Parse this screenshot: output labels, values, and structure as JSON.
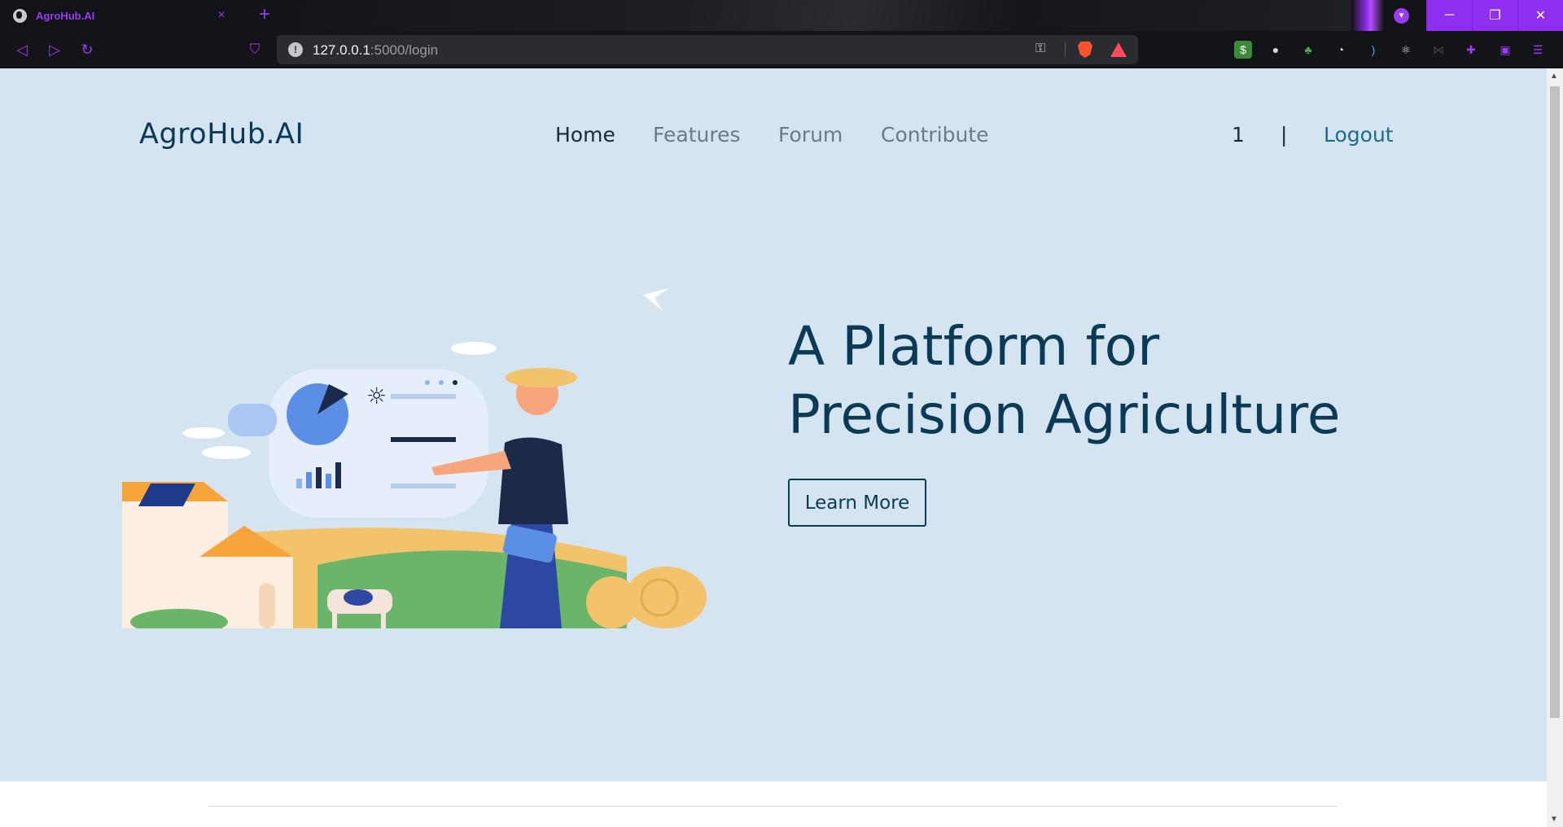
{
  "browser": {
    "tab_title": "AgroHub.AI",
    "tab_close": "×",
    "new_tab": "+",
    "url_host": "127.0.0.1",
    "url_path": ":5000/login",
    "window_buttons": {
      "minimize": "─",
      "restore": "❐",
      "close": "✕"
    },
    "accent_color": "#9a3cf3"
  },
  "nav": {
    "brand": "AgroHub.AI",
    "links": [
      "Home",
      "Features",
      "Forum",
      "Contribute"
    ],
    "active": "Home",
    "user_count": "1",
    "divider": "|",
    "logout": "Logout"
  },
  "hero": {
    "title_line1": "A Platform for",
    "title_line2": "Precision Agriculture",
    "cta": "Learn More"
  },
  "colors": {
    "page_bg": "#d5e4f1",
    "heading": "#0b3a57",
    "logout_link": "#1e6a8c"
  }
}
